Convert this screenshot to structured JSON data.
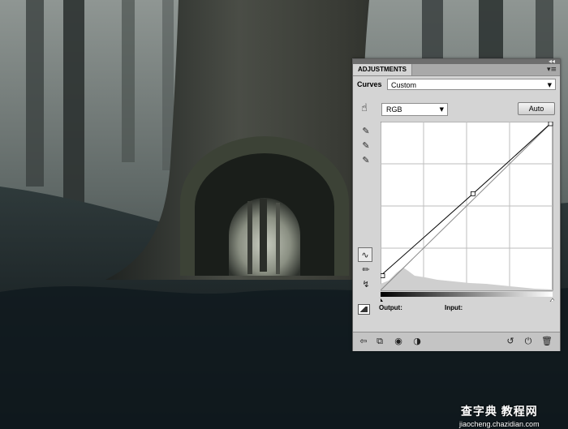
{
  "panel": {
    "tab_label": "ADJUSTMENTS",
    "collapse_glyph": "◂◂",
    "menu_glyph": "▾≡",
    "title": "Curves",
    "preset": "Custom",
    "channel": "RGB",
    "auto_label": "Auto",
    "output_label": "Output:",
    "input_label": "Input:",
    "tools": [
      "hand-target-icon",
      "black-point-eyedropper-icon",
      "gray-point-eyedropper-icon",
      "white-point-eyedropper-icon",
      "curve-points-icon",
      "pencil-icon",
      "smooth-icon"
    ],
    "footer_icons": [
      "return-arrow-icon",
      "clip-to-layer-icon",
      "visibility-eye-icon",
      "view-previous-icon",
      "reset-icon",
      "delete-icon"
    ]
  },
  "curve": {
    "range": [
      0,
      255
    ],
    "control_points": [
      [
        0,
        22
      ],
      [
        137,
        146
      ],
      [
        255,
        255
      ]
    ],
    "baseline": [
      [
        0,
        0
      ],
      [
        255,
        255
      ]
    ],
    "curve_color": "#000000",
    "grid_color": "#bdbdbd"
  },
  "watermark": {
    "line1": "查字典 教程网",
    "line2": "jiaocheng.chazidian.com"
  },
  "colors": {
    "panel_bg": "#d4d4d4",
    "accent_dark": "#6e6e6e"
  }
}
